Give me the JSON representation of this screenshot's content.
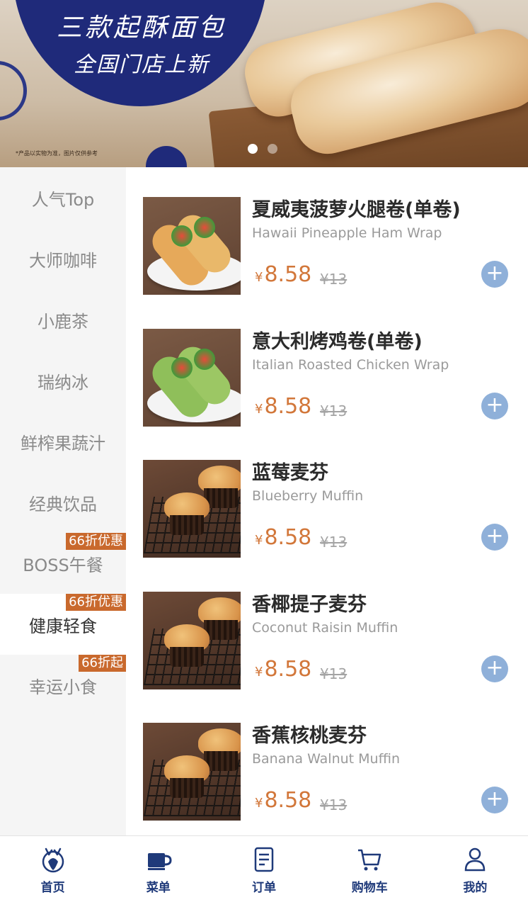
{
  "banner": {
    "headline": "三款起酥面包",
    "subline": "全国门店上新",
    "disclaimer": "*产品以实物为准，图片仅供参考",
    "slide_count": 2,
    "active_slide": 1
  },
  "sidebar": {
    "categories": [
      {
        "label": "人气Top",
        "badge": ""
      },
      {
        "label": "大师咖啡",
        "badge": ""
      },
      {
        "label": "小鹿茶",
        "badge": ""
      },
      {
        "label": "瑞纳冰",
        "badge": ""
      },
      {
        "label": "鲜榨果蔬汁",
        "badge": ""
      },
      {
        "label": "经典饮品",
        "badge": ""
      },
      {
        "label": "BOSS午餐",
        "badge": "66折优惠"
      },
      {
        "label": "健康轻食",
        "badge": "66折优惠"
      },
      {
        "label": "幸运小食",
        "badge": "66折起"
      }
    ],
    "active_index": 7
  },
  "products": [
    {
      "name": "夏威夷菠萝火腿卷(单卷)",
      "en": "Hawaii Pineapple Ham Wrap",
      "currency": "¥",
      "price": "8.58",
      "original": "¥13"
    },
    {
      "name": "意大利烤鸡卷(单卷)",
      "en": "Italian Roasted Chicken Wrap",
      "currency": "¥",
      "price": "8.58",
      "original": "¥13"
    },
    {
      "name": "蓝莓麦芬",
      "en": "Blueberry Muffin",
      "currency": "¥",
      "price": "8.58",
      "original": "¥13"
    },
    {
      "name": "香椰提子麦芬",
      "en": "Coconut Raisin Muffin",
      "currency": "¥",
      "price": "8.58",
      "original": "¥13"
    },
    {
      "name": "香蕉核桃麦芬",
      "en": "Banana Walnut Muffin",
      "currency": "¥",
      "price": "8.58",
      "original": "¥13"
    }
  ],
  "tabs": [
    {
      "label": "首页",
      "icon": "deer-icon"
    },
    {
      "label": "菜单",
      "icon": "cup-icon"
    },
    {
      "label": "订单",
      "icon": "receipt-icon"
    },
    {
      "label": "购物车",
      "icon": "cart-icon"
    },
    {
      "label": "我的",
      "icon": "user-icon"
    }
  ],
  "colors": {
    "brand_blue": "#1f2a7a",
    "price_orange": "#d2773a",
    "badge_orange": "#c9692d",
    "add_button": "#8fb0d9"
  }
}
